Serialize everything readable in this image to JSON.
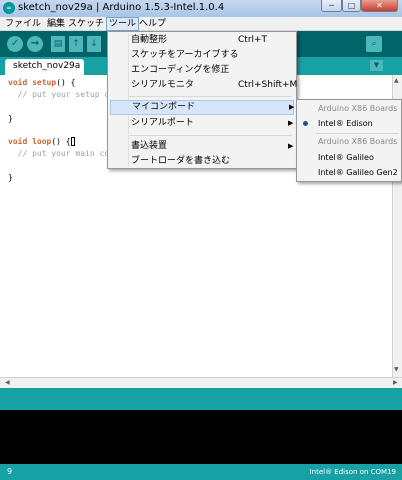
{
  "window": {
    "title": "sketch_nov29a | Arduino 1.5.3-Intel.1.0.4",
    "minimize_glyph": "─",
    "maximize_glyph": "□",
    "close_glyph": "✕",
    "app_icon_glyph": "∞"
  },
  "menubar": {
    "items": [
      {
        "label": "ファイル"
      },
      {
        "label": "編集"
      },
      {
        "label": "スケッチ"
      },
      {
        "label": "ツール"
      },
      {
        "label": "ヘルプ"
      }
    ]
  },
  "toolbar": {
    "verify_glyph": "✓",
    "upload_glyph": "→",
    "new_glyph": "▤",
    "open_glyph": "↑",
    "save_glyph": "↓",
    "monitor_glyph": "⌕"
  },
  "tabs": {
    "active_tab": "sketch_nov29a",
    "menu_glyph": "▼"
  },
  "editor": {
    "line1_kw1": "void",
    "line1_fn": "setup",
    "line1_rest": "() {",
    "line2": "  // put your setup code",
    "line3": "}",
    "line4_kw1": "void",
    "line4_fn": "loop",
    "line4_rest": "() {",
    "line5": "  // put your main code",
    "line6": "}"
  },
  "tools_menu": {
    "items": [
      {
        "label": "自動整形",
        "shortcut": "Ctrl+T"
      },
      {
        "label": "スケッチをアーカイブする",
        "shortcut": ""
      },
      {
        "label": "エンコーディングを修正",
        "shortcut": ""
      },
      {
        "label": "シリアルモニタ",
        "shortcut": "Ctrl+Shift+M"
      },
      {
        "label": "マイコンボード",
        "shortcut": ""
      },
      {
        "label": "シリアルポート",
        "shortcut": ""
      },
      {
        "label": "書込装置",
        "shortcut": ""
      },
      {
        "label": "ブートローダを書き込む",
        "shortcut": ""
      }
    ],
    "submenu_arrow": "▶"
  },
  "board_submenu": {
    "items": [
      {
        "label": "Arduino X86 Boards"
      },
      {
        "label": "Intel® Edison"
      },
      {
        "label": "Arduino X86 Boards"
      },
      {
        "label": "Intel® Galileo"
      },
      {
        "label": "Intel® Galileo Gen2"
      }
    ]
  },
  "scrollbars": {
    "up_glyph": "▲",
    "down_glyph": "▼",
    "left_glyph": "◀",
    "right_glyph": "▶"
  },
  "status": {
    "line_number": "9",
    "board_port": "Intel® Edison on COM19"
  },
  "colors": {
    "toolbar_bg": "#006468",
    "tabbar_bg": "#17a1a5",
    "keyword": "#cc6633"
  }
}
